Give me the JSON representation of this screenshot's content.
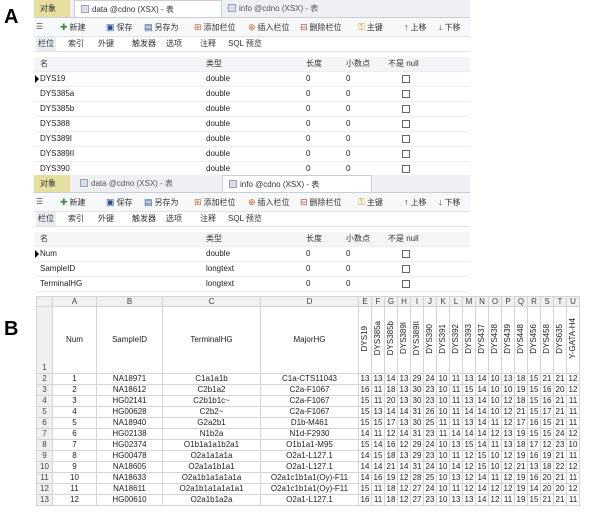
{
  "panel_labels": {
    "a": "A",
    "b": "B"
  },
  "top_window": {
    "tabs": [
      {
        "label": "对象",
        "kind": "objects"
      },
      {
        "label": "data @cdno (XSX) - 表",
        "kind": "active"
      },
      {
        "label": "info @cdno (XSX) - 表",
        "kind": "inactive"
      }
    ],
    "toolbar": {
      "new": "新建",
      "save": "保存",
      "save_as": "另存为",
      "add_col": "添加栏位",
      "insert_col": "插入栏位",
      "delete_col": "删除栏位",
      "primary_key": "主键",
      "move_up": "上移",
      "move_down": "下移"
    },
    "subtabs": [
      "栏位",
      "索引",
      "外键",
      "触发器",
      "选项",
      "注释",
      "SQL 预览"
    ],
    "columns": [
      "名",
      "类型",
      "长度",
      "小数点",
      "不是 null"
    ],
    "rows": [
      {
        "name": "DYS19",
        "type": "double",
        "length": "0",
        "decimals": "0"
      },
      {
        "name": "DYS385a",
        "type": "double",
        "length": "0",
        "decimals": "0"
      },
      {
        "name": "DYS385b",
        "type": "double",
        "length": "0",
        "decimals": "0"
      },
      {
        "name": "DYS388",
        "type": "double",
        "length": "0",
        "decimals": "0"
      },
      {
        "name": "DYS389I",
        "type": "double",
        "length": "0",
        "decimals": "0"
      },
      {
        "name": "DYS389II",
        "type": "double",
        "length": "0",
        "decimals": "0"
      },
      {
        "name": "DYS390",
        "type": "double",
        "length": "0",
        "decimals": "0"
      }
    ]
  },
  "bottom_window": {
    "tabs": [
      {
        "label": "对象",
        "kind": "objects"
      },
      {
        "label": "data @cdno (XSX) - 表",
        "kind": "inactive"
      },
      {
        "label": "info @cdno (XSX) - 表",
        "kind": "active"
      }
    ],
    "toolbar": {
      "new": "新建",
      "save": "保存",
      "save_as": "另存为",
      "add_col": "添加栏位",
      "insert_col": "插入栏位",
      "delete_col": "删除栏位",
      "primary_key": "主键",
      "move_up": "上移",
      "move_down": "下移"
    },
    "subtabs": [
      "栏位",
      "索引",
      "外键",
      "触发器",
      "选项",
      "注释",
      "SQL 预览"
    ],
    "columns": [
      "名",
      "类型",
      "长度",
      "小数点",
      "不是 null"
    ],
    "rows": [
      {
        "name": "Num",
        "type": "double",
        "length": "0",
        "decimals": "0"
      },
      {
        "name": "SampleID",
        "type": "longtext",
        "length": "0",
        "decimals": "0"
      },
      {
        "name": "TerminalHG",
        "type": "longtext",
        "length": "0",
        "decimals": "0"
      }
    ]
  },
  "spreadsheet": {
    "col_letters": [
      "A",
      "B",
      "C",
      "D",
      "E",
      "F",
      "G",
      "H",
      "I",
      "J",
      "K",
      "L",
      "M",
      "N",
      "O",
      "P",
      "Q",
      "R",
      "S",
      "T",
      "U"
    ],
    "headers": [
      "Num",
      "SampleID",
      "TerminalHG",
      "MajorHG",
      "DYS19",
      "DYS385a",
      "DYS385b",
      "DYS389I",
      "DYS389II",
      "DYS390",
      "DYS391",
      "DYS392",
      "DYS393",
      "DYS437",
      "DYS438",
      "DYS439",
      "DYS448",
      "DYS456",
      "DYS458",
      "DYS635",
      "Y-GATA-H4"
    ],
    "rows": [
      [
        "1",
        "NA18971",
        "C1a1a1b",
        "C1a-CTS11043",
        "13",
        "13",
        "14",
        "13",
        "29",
        "24",
        "10",
        "11",
        "13",
        "14",
        "10",
        "13",
        "18",
        "15",
        "21",
        "21",
        "12"
      ],
      [
        "2",
        "NA18612",
        "C2b1a2",
        "C2a-F1067",
        "16",
        "11",
        "18",
        "13",
        "30",
        "23",
        "10",
        "11",
        "15",
        "14",
        "10",
        "10",
        "19",
        "15",
        "16",
        "20",
        "12"
      ],
      [
        "3",
        "HG02141",
        "C2b1b1c~",
        "C2a-F1067",
        "15",
        "11",
        "20",
        "13",
        "30",
        "23",
        "10",
        "11",
        "13",
        "14",
        "10",
        "12",
        "18",
        "15",
        "16",
        "21",
        "11"
      ],
      [
        "4",
        "HG00628",
        "C2b2~",
        "C2a-F1067",
        "15",
        "13",
        "14",
        "14",
        "31",
        "26",
        "10",
        "11",
        "14",
        "14",
        "10",
        "12",
        "21",
        "15",
        "17",
        "21",
        "11"
      ],
      [
        "5",
        "NA18940",
        "G2a2b1",
        "D1b-M461",
        "15",
        "15",
        "17",
        "13",
        "30",
        "25",
        "11",
        "11",
        "13",
        "14",
        "11",
        "12",
        "17",
        "16",
        "15",
        "21",
        "11"
      ],
      [
        "6",
        "HG02138",
        "N1b2a",
        "N1d-F2930",
        "14",
        "11",
        "12",
        "14",
        "31",
        "23",
        "11",
        "14",
        "14",
        "14",
        "12",
        "13",
        "19",
        "15",
        "15",
        "24",
        "12"
      ],
      [
        "7",
        "HG02374",
        "O1b1a1a1b2a1",
        "O1b1a1-M95",
        "15",
        "14",
        "16",
        "12",
        "29",
        "24",
        "10",
        "13",
        "15",
        "14",
        "11",
        "13",
        "18",
        "17",
        "12",
        "23",
        "10"
      ],
      [
        "8",
        "HG00478",
        "O2a1a1a1a",
        "O2a1-L127.1",
        "14",
        "15",
        "18",
        "13",
        "29",
        "23",
        "10",
        "11",
        "12",
        "15",
        "10",
        "12",
        "19",
        "16",
        "19",
        "21",
        "11"
      ],
      [
        "9",
        "NA18605",
        "O2a1a1b1a1",
        "O2a1-L127.1",
        "14",
        "14",
        "21",
        "14",
        "31",
        "24",
        "10",
        "14",
        "12",
        "15",
        "10",
        "12",
        "21",
        "13",
        "18",
        "22",
        "12"
      ],
      [
        "10",
        "NA18633",
        "O2a1b1a1a1a1a",
        "O2a1c1b1a1(Oy)-F11",
        "14",
        "16",
        "19",
        "12",
        "28",
        "25",
        "10",
        "13",
        "12",
        "14",
        "11",
        "12",
        "19",
        "16",
        "20",
        "21",
        "11"
      ],
      [
        "11",
        "NA18611",
        "O2a1b1a1a1a1a1",
        "O2a1c1b1a1(Oy)-F11",
        "15",
        "11",
        "18",
        "12",
        "27",
        "24",
        "10",
        "11",
        "12",
        "14",
        "12",
        "12",
        "19",
        "14",
        "20",
        "20",
        "12"
      ],
      [
        "12",
        "HG00610",
        "O2a1b1a2a",
        "O2a1-L127.1",
        "16",
        "11",
        "18",
        "12",
        "27",
        "23",
        "10",
        "13",
        "13",
        "14",
        "12",
        "11",
        "19",
        "15",
        "21",
        "21",
        "11"
      ]
    ]
  }
}
